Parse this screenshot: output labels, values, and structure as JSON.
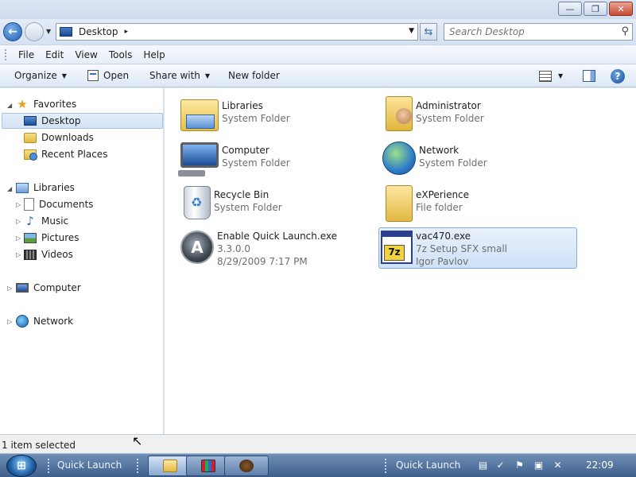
{
  "window": {
    "controls": {
      "minimize": "—",
      "maximize": "❐",
      "close": "✕"
    }
  },
  "navbar": {
    "address": "Desktop",
    "address_sep": "▸",
    "search_placeholder": "Search Desktop"
  },
  "menu": [
    "File",
    "Edit",
    "View",
    "Tools",
    "Help"
  ],
  "commands": {
    "organize": "Organize",
    "open": "Open",
    "share_with": "Share with",
    "new_folder": "New folder"
  },
  "navpane": {
    "favorites": "Favorites",
    "favorites_items": [
      "Desktop",
      "Downloads",
      "Recent Places"
    ],
    "libraries": "Libraries",
    "libraries_items": [
      "Documents",
      "Music",
      "Pictures",
      "Videos"
    ],
    "computer": "Computer",
    "network": "Network"
  },
  "items": [
    {
      "name": "Libraries",
      "line2": "System Folder",
      "line3": "",
      "icon": "libraries-icon"
    },
    {
      "name": "Administrator",
      "line2": "System Folder",
      "line3": "",
      "icon": "user-folder-icon"
    },
    {
      "name": "Computer",
      "line2": "System Folder",
      "line3": "",
      "icon": "computer-icon"
    },
    {
      "name": "Network",
      "line2": "System Folder",
      "line3": "",
      "icon": "network-icon"
    },
    {
      "name": "Recycle Bin",
      "line2": "System Folder",
      "line3": "",
      "icon": "recycle-bin-icon"
    },
    {
      "name": "eXPerience",
      "line2": "File folder",
      "line3": "",
      "icon": "folder-icon"
    },
    {
      "name": "Enable Quick Launch.exe",
      "line2": "3.3.0.0",
      "line3": "8/29/2009 7:17 PM",
      "icon": "quick-launch-app-icon"
    },
    {
      "name": "vac470.exe",
      "line2": "7z Setup SFX small",
      "line3": "Igor Pavlov",
      "icon": "7z-setup-icon",
      "selected": true
    }
  ],
  "status": "1 item selected",
  "taskbar": {
    "start_label": "⊞",
    "quick_launch_1": "Quick Launch",
    "quick_launch_2": "Quick Launch",
    "clock": "22:09"
  },
  "colors": {
    "selection": "#cfe1f6",
    "selection_border": "#84acdd",
    "taskbar": "#3e5f8c"
  }
}
